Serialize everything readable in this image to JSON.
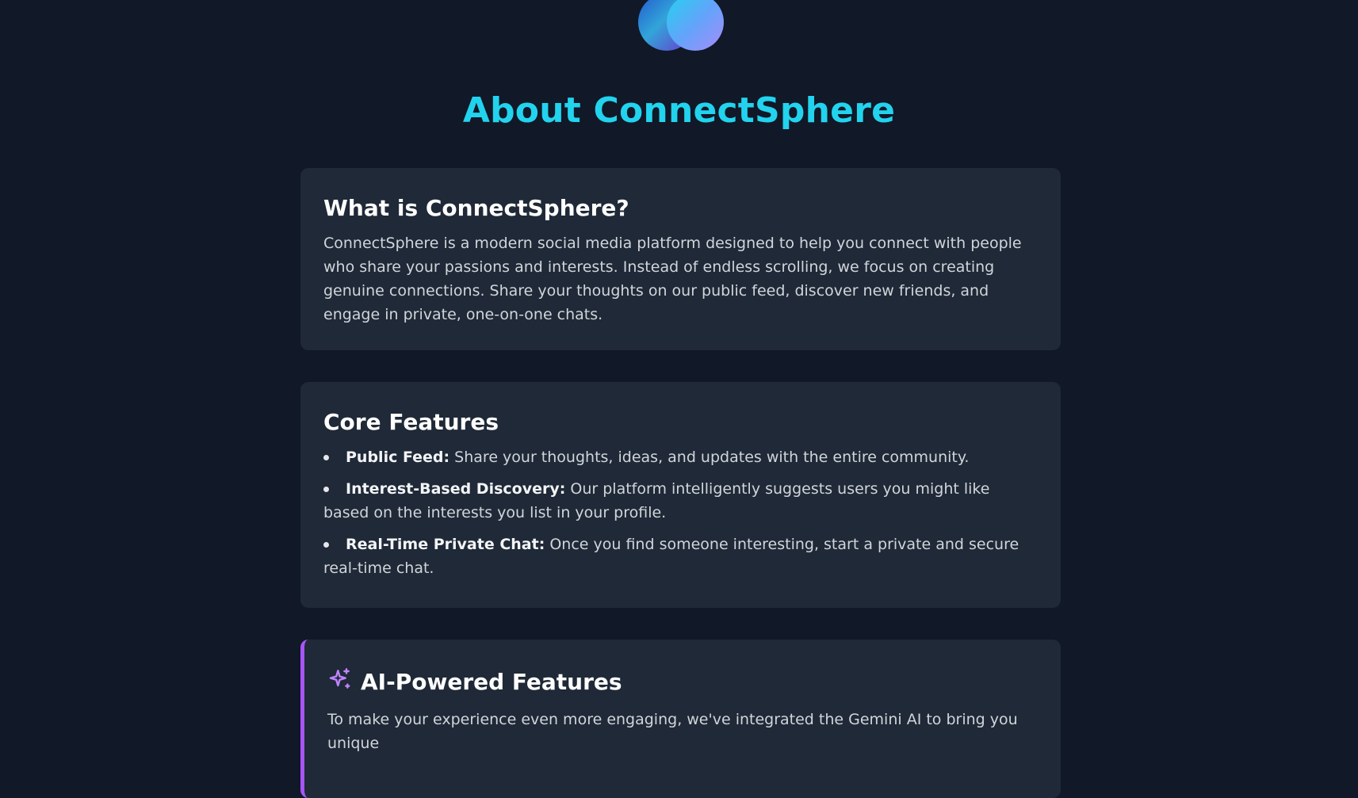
{
  "page": {
    "title": "About ConnectSphere"
  },
  "logo": {
    "icon": "overlapping-circles-logo",
    "colors": [
      "#2563eb",
      "#22d3ee",
      "#a78bfa"
    ]
  },
  "sections": {
    "what": {
      "heading": "What is ConnectSphere?",
      "body": "ConnectSphere is a modern social media platform designed to help you connect with people who share your passions and interests. Instead of endless scrolling, we focus on creating genuine connections. Share your thoughts on our public feed, discover new friends, and engage in private, one-on-one chats."
    },
    "core": {
      "heading": "Core Features",
      "items": [
        {
          "label": "Public Feed:",
          "text": " Share your thoughts, ideas, and updates with the entire community."
        },
        {
          "label": "Interest-Based Discovery:",
          "text": " Our platform intelligently suggests users you might like based on the interests you list in your profile."
        },
        {
          "label": "Real-Time Private Chat:",
          "text": " Once you find someone interesting, start a private and secure real-time chat."
        }
      ]
    },
    "ai": {
      "icon": "sparkles-icon",
      "heading": "AI-Powered Features",
      "body": "To make your experience even more engaging, we've integrated the Gemini AI to bring you unique"
    }
  },
  "colors": {
    "background": "#111827",
    "card": "#1f2937",
    "title": "#22d3ee",
    "ai_accent": "#a855f7"
  }
}
